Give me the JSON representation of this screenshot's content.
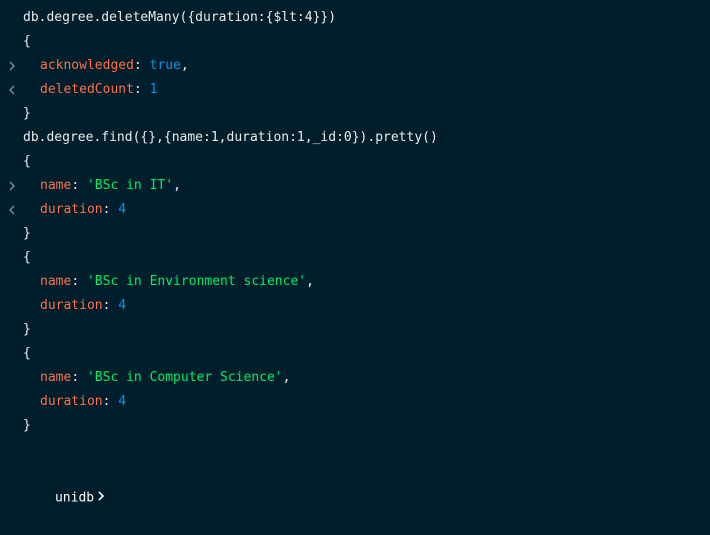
{
  "shell": {
    "commands": [
      "db.degree.deleteMany({duration:{$lt:4}})",
      "db.degree.find({},{name:1,duration:1,_id:0}).pretty()"
    ],
    "delete_result": {
      "open": "{",
      "close": "}",
      "acknowledged_key": "acknowledged",
      "acknowledged_value": "true",
      "deleted_key": "deletedCount",
      "deleted_value": "1"
    },
    "documents": [
      {
        "name_key": "name",
        "name_value": "'BSc in IT'",
        "duration_key": "duration",
        "duration_value": "4"
      },
      {
        "name_key": "name",
        "name_value": "'BSc in Environment science'",
        "duration_key": "duration",
        "duration_value": "4"
      },
      {
        "name_key": "name",
        "name_value": "'BSc in Computer Science'",
        "duration_key": "duration",
        "duration_value": "4"
      }
    ],
    "prompt": "unidb",
    "icons": {
      "input": "chevron-right-icon",
      "output": "chevron-left-icon",
      "prompt": "chevron-right-icon"
    },
    "colors": {
      "background": "#001e2b",
      "key": "#ff6f44",
      "number": "#0498ec",
      "string": "#00ed64",
      "text": "#e8edeb"
    }
  }
}
